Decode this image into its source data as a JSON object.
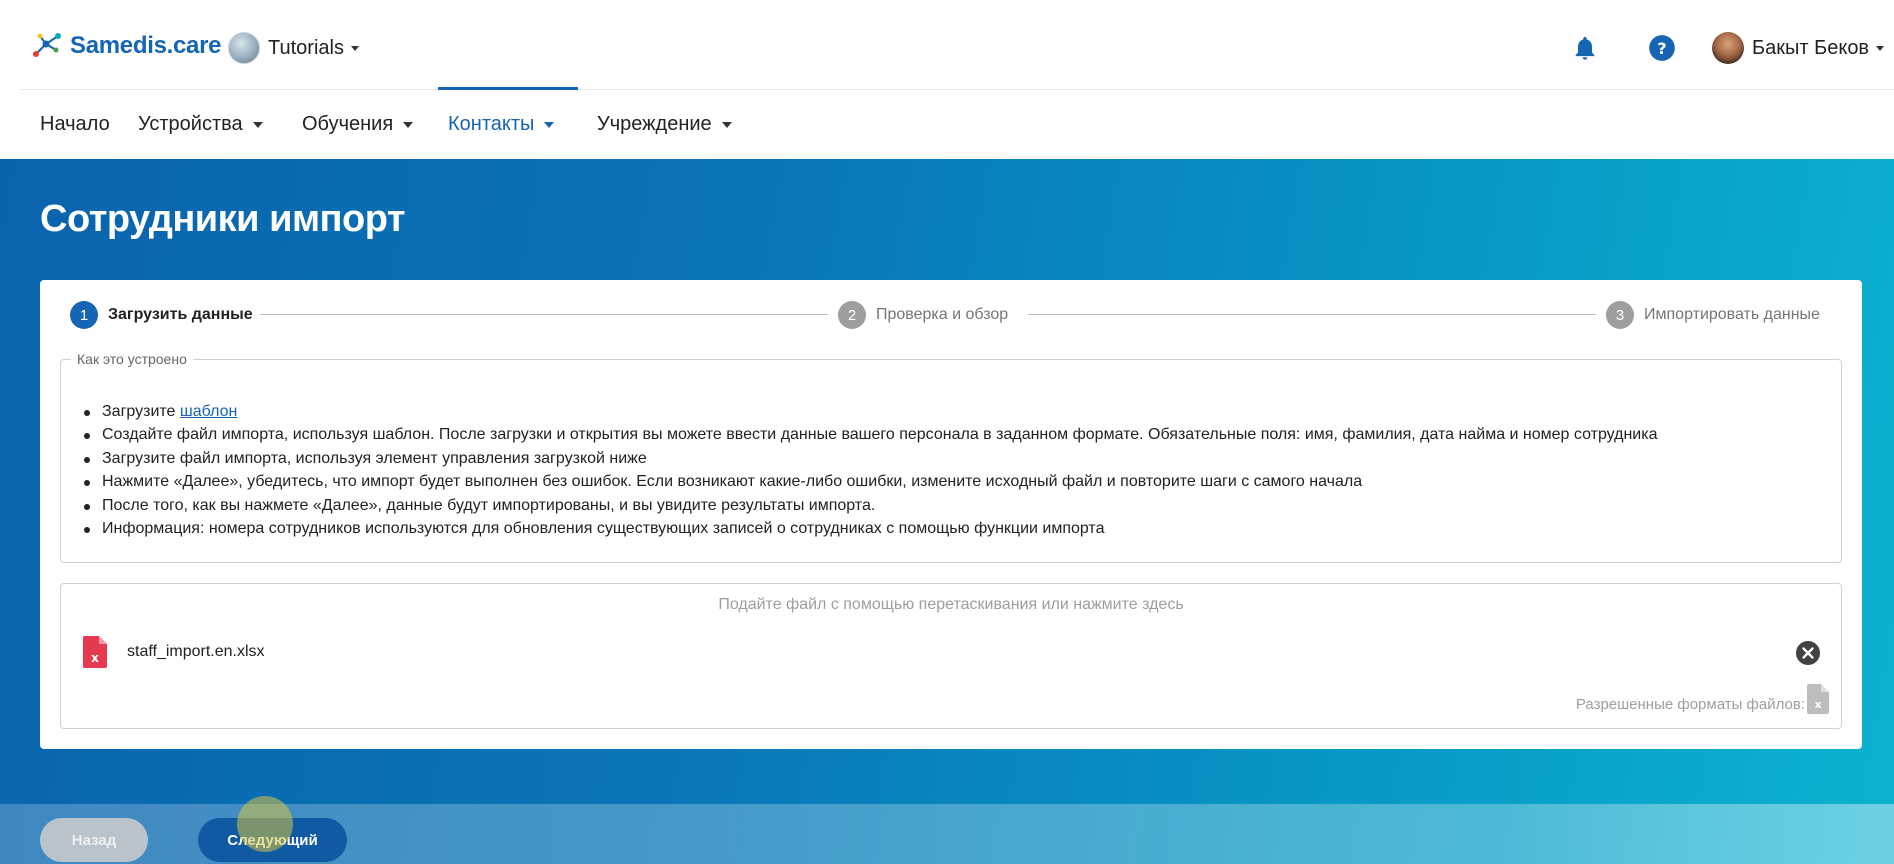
{
  "header": {
    "logo_text": "Samedis.care",
    "tenant_name": "Tutorials",
    "user_name": "Бакыт Беков",
    "icons": [
      "bell-icon",
      "help-icon"
    ],
    "accent_color": "#1565b4"
  },
  "nav": {
    "items": [
      {
        "label": "Начало",
        "has_dropdown": false
      },
      {
        "label": "Устройства",
        "has_dropdown": true
      },
      {
        "label": "Обучения",
        "has_dropdown": true
      },
      {
        "label": "Контакты",
        "has_dropdown": true,
        "active": true
      },
      {
        "label": "Учреждение",
        "has_dropdown": true
      }
    ]
  },
  "page": {
    "title": "Сотрудники импорт"
  },
  "stepper": {
    "steps": [
      {
        "number": "1",
        "label": "Загрузить данные",
        "active": true
      },
      {
        "number": "2",
        "label": "Проверка и обзор",
        "active": false
      },
      {
        "number": "3",
        "label": "Импортировать данные",
        "active": false
      }
    ]
  },
  "howto": {
    "legend": "Как это устроено",
    "first_item_prefix": "Загрузите ",
    "template_link": "шаблон",
    "items": [
      "Создайте файл импорта, используя шаблон. После загрузки и открытия вы можете ввести данные вашего персонала в заданном формате. Обязательные поля: имя, фамилия, дата найма и номер сотрудника",
      "Загрузите файл импорта, используя элемент управления загрузкой ниже",
      "Нажмите «Далее», убедитесь, что импорт будет выполнен без ошибок. Если возникают какие-либо ошибки, измените исходный файл и повторите шаги с самого начала",
      "После того, как вы нажмете «Далее», данные будут импортированы, и вы увидите результаты импорта.",
      "Информация: номера сотрудников используются для обновления существующих записей о сотрудниках с помощью функции импорта"
    ]
  },
  "dropzone": {
    "hint": "Подайте файл с помощью перетаскивания или нажмите здесь",
    "file_name": "staff_import.en.xlsx",
    "allowed_formats_label": "Разрешенные форматы файлов:"
  },
  "footer": {
    "back_label": "Назад",
    "next_label": "Следующий"
  }
}
